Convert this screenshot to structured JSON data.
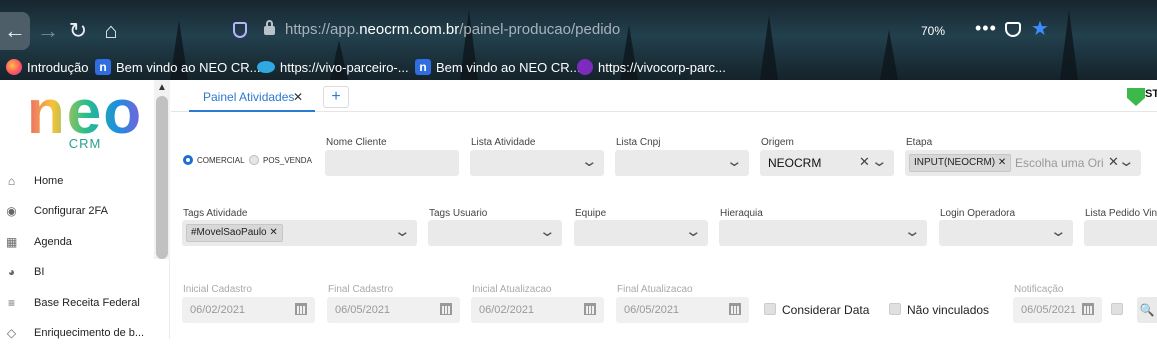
{
  "browser": {
    "url_scheme": "https://app.",
    "url_domain": "neocrm.com.br",
    "url_path": "/painel-producao/pedido",
    "zoom": "70%",
    "more_menu": "•••",
    "bookmarks": [
      {
        "label": "Introdução",
        "icon": "firefox-icon"
      },
      {
        "label": "Bem vindo ao NEO CR...",
        "icon": "neo-icon"
      },
      {
        "label": "https://vivo-parceiro-...",
        "icon": "cloud-icon"
      },
      {
        "label": "Bem vindo ao NEO CR...",
        "icon": "neo-icon"
      },
      {
        "label": "https://vivocorp-parc...",
        "icon": "vivo-icon"
      }
    ]
  },
  "sidebar": {
    "logo_word": "neo",
    "logo_sub": "CRM",
    "items": [
      {
        "label": "Home",
        "icon": "home-icon"
      },
      {
        "label": "Configurar 2FA",
        "icon": "target-icon"
      },
      {
        "label": "Agenda",
        "icon": "calendar-icon"
      },
      {
        "label": "BI",
        "icon": "pie-chart-icon"
      },
      {
        "label": "Base Receita Federal",
        "icon": "database-icon"
      },
      {
        "label": "Enriquecimento de b...",
        "icon": "diamond-icon"
      }
    ]
  },
  "tabs": {
    "active": "Painel Atividades",
    "close": "✕",
    "add": "+"
  },
  "brand_badge": "ST",
  "filters": {
    "radio_comercial": "COMERCIAL",
    "radio_posvenda": "POS_VENDA",
    "nome_cliente": "Nome Cliente",
    "lista_atividade": "Lista Atividade",
    "lista_cnpj": "Lista Cnpj",
    "origem": "Origem",
    "origem_value": "NEOCRM",
    "etapa": "Etapa",
    "etapa_chip": "INPUT(NEOCRM)",
    "etapa_placeholder": "Escolha uma Origem",
    "tags_atividade": "Tags Atividade",
    "tags_atividade_chip": "#MovelSaoPaulo",
    "tags_usuario": "Tags Usuario",
    "equipe": "Equipe",
    "hierarquia": "Hieraquia",
    "login_operadora": "Login Operadora",
    "lista_pedido": "Lista Pedido Vinc",
    "inicial_cadastro": "Inicial Cadastro",
    "inicial_cadastro_value": "06/02/2021",
    "final_cadastro": "Final Cadastro",
    "final_cadastro_value": "06/05/2021",
    "inicial_atualizacao": "Inicial Atualizacao",
    "inicial_atualizacao_value": "06/02/2021",
    "final_atualizacao": "Final Atualizacao",
    "final_atualizacao_value": "06/05/2021",
    "considerar_data": "Considerar Data",
    "nao_vinculados": "Não vinculados",
    "notificacao": "Notificação",
    "notificacao_value": "06/05/2021"
  },
  "colors": {
    "accent": "#2a7bd1",
    "field_bg": "#eaeaea"
  }
}
